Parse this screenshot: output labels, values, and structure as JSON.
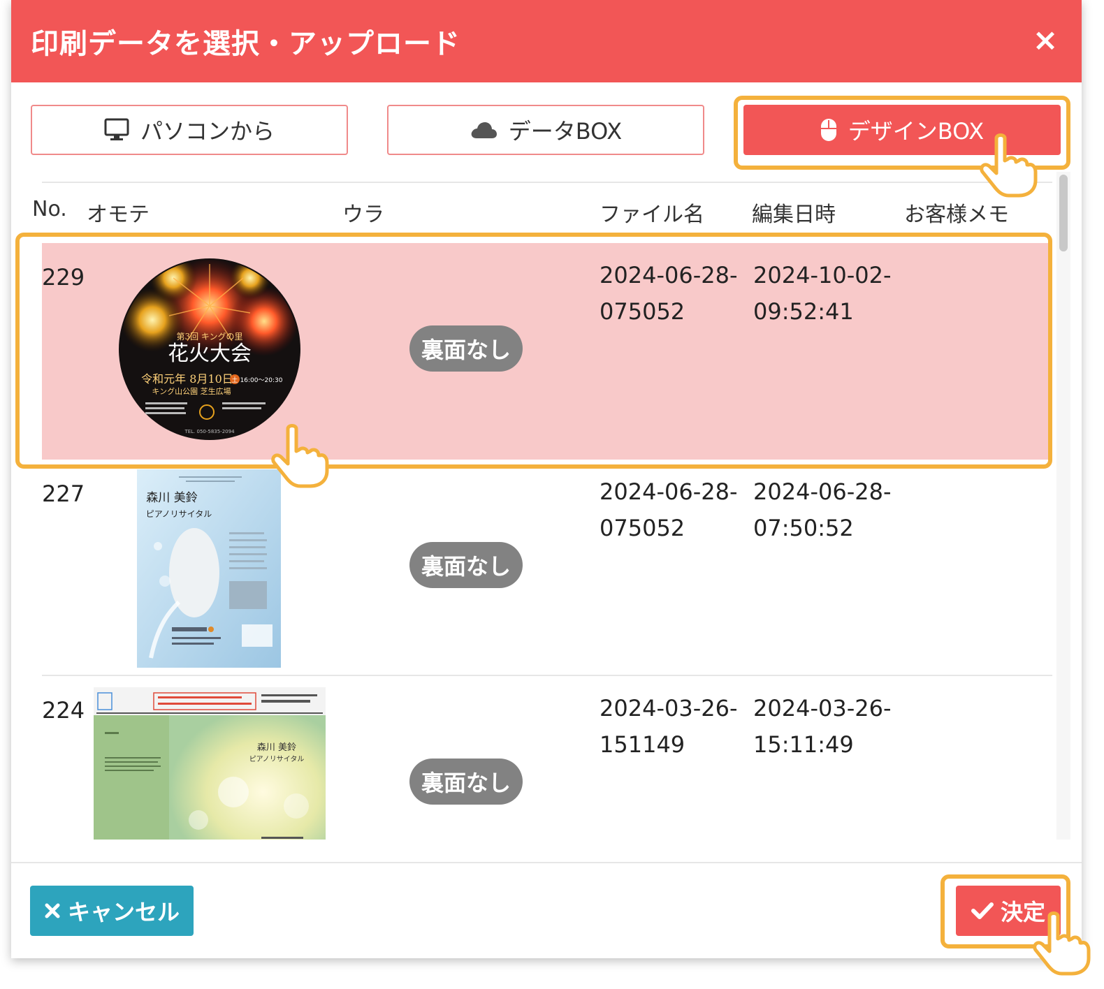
{
  "dialog": {
    "title": "印刷データを選択・アップロード",
    "close_icon": "close-icon"
  },
  "sources": [
    {
      "label": "パソコンから",
      "icon": "monitor-icon",
      "active": false
    },
    {
      "label": "データBOX",
      "icon": "cloud-icon",
      "active": false
    },
    {
      "label": "デザインBOX",
      "icon": "mouse-icon",
      "active": true
    }
  ],
  "table": {
    "headers": {
      "no": "No.",
      "front": "オモテ",
      "back": "ウラ",
      "filename": "ファイル名",
      "edited": "編集日時",
      "memo": "お客様メモ"
    },
    "rows": [
      {
        "no": "229",
        "back": "裏面なし",
        "filename_line1": "2024-06-28-",
        "filename_line2": "075052",
        "date_line1": "2024-10-02-",
        "date_line2": "09:52:41",
        "selected": true,
        "thumb": {
          "kind": "round-fireworks-flyer",
          "line1": "第3回 キングの里",
          "title": "花火大会",
          "date": "令和元年 8月10日",
          "weekday": "土",
          "time": "16:00～20:30",
          "venue": "キング山公園 芝生広場",
          "tel": "TEL. 050-5835-2094"
        }
      },
      {
        "no": "227",
        "back": "裏面なし",
        "filename_line1": "2024-06-28-",
        "filename_line2": "075052",
        "date_line1": "2024-06-28-",
        "date_line2": "07:50:52",
        "selected": false,
        "thumb": {
          "kind": "recital-flyer",
          "name": "森川 美鈴",
          "subtitle": "ピアノリサイタル"
        }
      },
      {
        "no": "224",
        "back": "裏面なし",
        "filename_line1": "2024-03-26-",
        "filename_line2": "151149",
        "date_line1": "2024-03-26-",
        "date_line2": "15:11:49",
        "selected": false,
        "thumb": {
          "kind": "recital-program-spread",
          "name": "森川 美鈴",
          "subtitle": "ピアノリサイタル"
        }
      }
    ]
  },
  "footer": {
    "cancel_label": "キャンセル",
    "cancel_icon": "x-icon",
    "ok_label": "決定",
    "ok_icon": "check-icon"
  },
  "colors": {
    "header": "#f25656",
    "accent_red": "#f25656",
    "selected_row": "#f8c9c9",
    "cancel": "#2da4bd",
    "badge": "#828282",
    "highlight": "#f4b13c"
  }
}
